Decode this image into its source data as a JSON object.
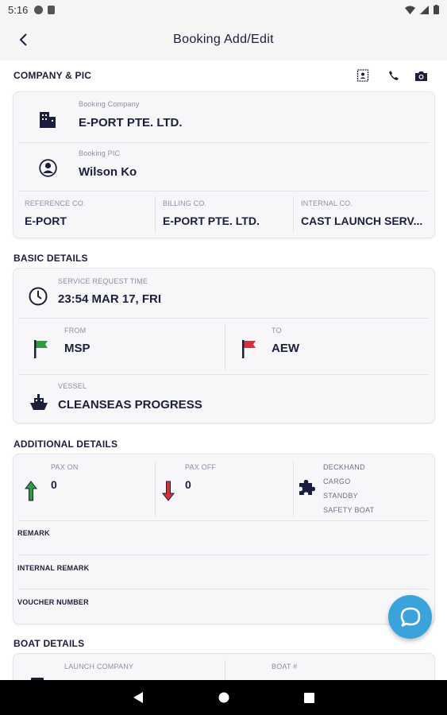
{
  "status_bar": {
    "time": "5:16"
  },
  "app_bar": {
    "title": "Booking Add/Edit"
  },
  "company_section": {
    "title": "COMPANY & PIC",
    "booking_company_label": "Booking Company",
    "booking_company": "E-PORT PTE. LTD.",
    "booking_pic_label": "Booking PIC",
    "booking_pic": "Wilson Ko",
    "reference_label": "REFERENCE CO.",
    "reference_value": "E-PORT",
    "billing_label": "BILLING CO.",
    "billing_value": "E-PORT PTE. LTD.",
    "internal_label": "INTERNAL CO.",
    "internal_value": "CAST LAUNCH SERV..."
  },
  "basic_section": {
    "title": "BASIC DETAILS",
    "service_time_label": "SERVICE REQUEST TIME",
    "service_time": "23:54 MAR 17, FRI",
    "from_label": "FROM",
    "from_value": "MSP",
    "to_label": "TO",
    "to_value": "AEW",
    "vessel_label": "VESSEL",
    "vessel_value": "CLEANSEAS PROGRESS"
  },
  "additional_section": {
    "title": "ADDITIONAL DETAILS",
    "pax_on_label": "PAX ON",
    "pax_on": "0",
    "pax_off_label": "PAX OFF",
    "pax_off": "0",
    "services": [
      "DECKHAND",
      "CARGO",
      "STANDBY",
      "SAFETY BOAT"
    ],
    "remark_label": "REMARK",
    "internal_remark_label": "INTERNAL REMARK",
    "voucher_label": "VOUCHER NUMBER"
  },
  "boat_section": {
    "title": "BOAT DETAILS",
    "launch_company_label": "LAUNCH COMPANY",
    "boat_no_label": "BOAT #"
  },
  "colors": {
    "accent": "#3aa3dc",
    "text": "#1b1f3b",
    "flag_from": "#2e9d3e",
    "flag_to": "#d8303b",
    "arrow_up": "#2e9d3e",
    "arrow_down": "#d8303b"
  },
  "icons": [
    "back-arrow-icon",
    "contact-card-icon",
    "phone-icon",
    "camera-icon",
    "building-icon",
    "person-icon",
    "clock-icon",
    "green-flag-icon",
    "red-flag-icon",
    "ship-icon",
    "arrow-up-icon",
    "arrow-down-icon",
    "puzzle-icon",
    "chat-icon"
  ]
}
